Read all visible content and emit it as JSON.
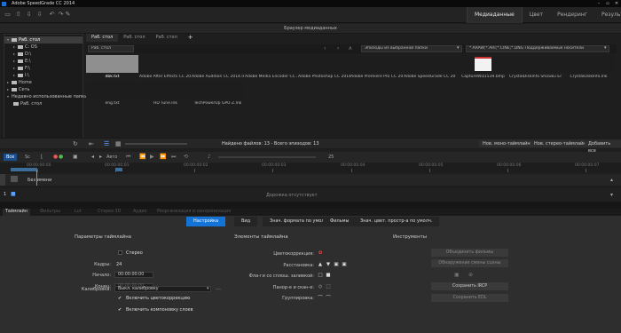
{
  "window": {
    "title": "Adobe SpeedGrade CC 2014",
    "controls": [
      "–",
      "▫",
      "✕"
    ]
  },
  "workspaces": [
    "Медиаданные",
    "Цвет",
    "Рендеринг",
    "Результат"
  ],
  "browser": {
    "title": "Браузер медиаданных",
    "sidebar": {
      "items": [
        {
          "label": "Раб. стол"
        },
        {
          "label": "C: OS"
        },
        {
          "label": "D:\\"
        },
        {
          "label": "E:\\"
        },
        {
          "label": "F:\\"
        },
        {
          "label": "I:\\"
        },
        {
          "label": "Home"
        },
        {
          "label": "Сеть"
        },
        {
          "label": "Недавно использованные папки"
        },
        {
          "label": "Раб. стол"
        }
      ]
    },
    "tabs": [
      "Раб. стол",
      "Раб. стол",
      "Раб. стол"
    ],
    "add_tab": "+",
    "path": "Раб. стол",
    "episodes_filter": "Эпизоды из выбранной папки",
    "file_filter": "*.ARAW;*.ARI;*.CINE;*.DNG Поддерживаемые носители",
    "files": [
      "dbk.txt",
      "Adobe After Effects CC 2014.lnk",
      "Adobe Audition CC 2014.lnk",
      "Adobe Media Encoder CC 2014.lnk",
      "Adobe Photoshop CC 2014.lnk",
      "Adobe Premiere Pro CC 2014.lnk",
      "Adobe SpeedGrade CC 2014.lnk",
      "CaptureWiz1539.bmp",
      "CrystalDiskInfo Shizuku Edition.lnk",
      "CrystalDiskInfo.lnk",
      "eng.txt",
      "HD Tune.lnk",
      "TechPowerUp GPU-Z.lnk"
    ],
    "status": "Найдено файлов: 13 - Всего эпизодов: 13",
    "buttons": {
      "new_mono": "Нов. моно-таймлайн",
      "new_stereo": "Нов. стерео-таймлайн",
      "add_all": "Добавить все"
    }
  },
  "timeline": {
    "fps": "Все",
    "mode": "Sc",
    "auto": "Авто",
    "bar_value": "25",
    "timecodes": [
      "00:00:00:00",
      "00:00:00:01",
      "00:00:00:02",
      "00:00:00:03",
      "00:00:00:04",
      "00:00:00:05",
      "00:00:00:06",
      "00:00:00:07"
    ],
    "track_name": "Без имени",
    "track_num": "1",
    "empty_track": "Дорожка отсутствует"
  },
  "inspector": {
    "top_tabs": [
      "Таймлайн",
      "Фильтры",
      "Lut",
      "Стерео 3D",
      "Аудио",
      "Реорганизация и синхронизация"
    ],
    "subtabs": [
      "Настройка",
      "Вид",
      "Знач. формата по умолч.",
      "Фильмы",
      "Знач. цвет. простр-а по умолч."
    ],
    "params": {
      "heading": "Параметры таймлайна",
      "stereo": "Стерео",
      "frames_label": "Кадры:",
      "frames": "24",
      "start_label": "Начало:",
      "start": "00:00:00:00",
      "end_label": "Конец:",
      "end": "00:00:00:00",
      "calib_label": "Калибровка:",
      "calib": "Выкл. калибровку",
      "enable_color": "Включить цветокоррекцию",
      "enable_layers": "Включить компоновку слоев"
    },
    "elements": {
      "heading": "Элементы таймлайна",
      "color_corr": "Цветокоррекция:",
      "layout": "Расстановка:",
      "flags": "Фла-ги со сплош. заливкой:",
      "pan": "Панор-е и скан-е:",
      "grouping": "Группировка:"
    },
    "tools": {
      "heading": "Инструменты",
      "merge": "Объединить фильмы",
      "detect": "Обнаружение смены сцены",
      "save_ircp": "Сохранить IRCP",
      "save_edl": "Сохранить EDL"
    }
  },
  "colors": {
    "accent": "#1473d6",
    "bg": "#1e1e1e"
  }
}
